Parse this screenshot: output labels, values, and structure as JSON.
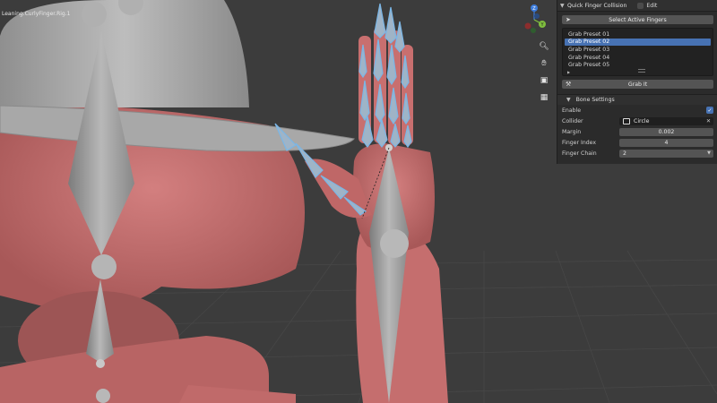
{
  "viewport": {
    "object_label": "Leaning.CurlyFinger.Rig.1",
    "nav_icons": [
      "zoom-icon",
      "hand-pan-icon",
      "camera-icon",
      "perspective-grid-icon"
    ],
    "gizmo_axes": {
      "z": "Z",
      "y": "Y"
    },
    "colors": {
      "skin": "#c06a6a",
      "bone": "#9a9a9a",
      "hat": "#a7a7a7",
      "selected_bone": "#7ab6e6",
      "floor": "#3e3e3e"
    }
  },
  "panel": {
    "header_title": "Quick Finger Collision",
    "edit_label": "Edit",
    "select_button_label": "Select Active Fingers",
    "presets": [
      "Grab Preset 01",
      "Grab Preset 02",
      "Grab Preset 03",
      "Grab Preset 04",
      "Grab Preset 05"
    ],
    "selected_preset": "Grab Preset 02",
    "grab_button_label": "Grab It",
    "bone_settings_title": "Bone Settings",
    "props": {
      "enable_label": "Enable",
      "enable_value": true,
      "collider_label": "Collider",
      "collider_value": "Circle",
      "margin_label": "Margin",
      "margin_value": "0.002",
      "finger_index_label": "Finger Index",
      "finger_index_value": "4",
      "finger_chain_label": "Finger Chain",
      "finger_chain_value": "2"
    },
    "accent_color": "#4772b3"
  }
}
